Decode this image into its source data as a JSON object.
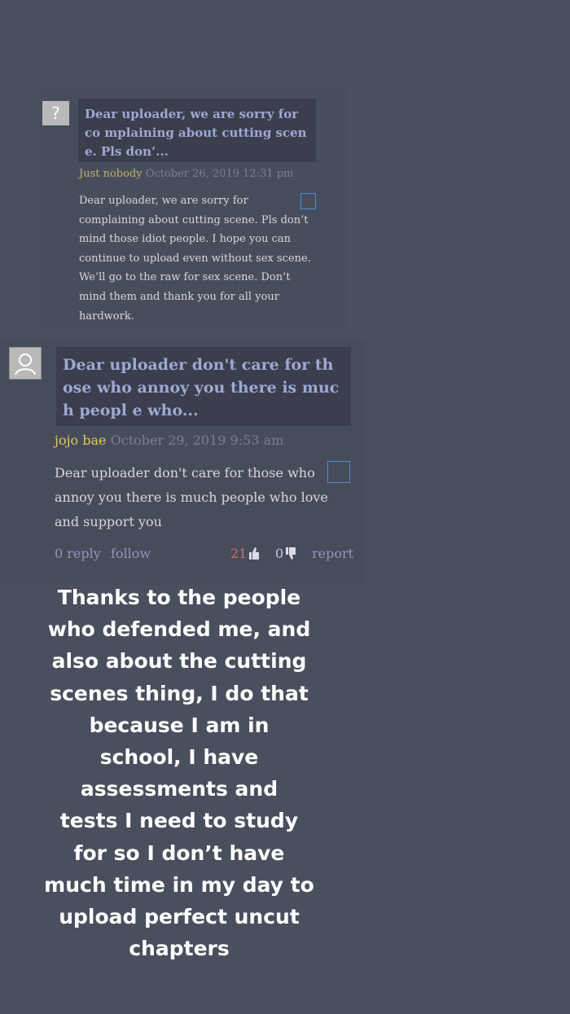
{
  "comment1": {
    "avatar_glyph": "?",
    "quote": "Dear uploader, we are sorry for co mplaining about cutting scene. Pls don’...",
    "username": "Just nobody",
    "timestamp": "October 26, 2019 12:31 pm",
    "body": "Dear uploader, we are sorry for complaining about cutting scene. Pls don’t mind those idiot people. I hope you can continue to upload even without sex scene. We’ll go to the raw for sex scene. Don’t mind them and thank you for all your hardwork."
  },
  "comment2": {
    "quote": "Dear uploader don't care for those who annoy you there is much peopl e who...",
    "username": "jojo bae",
    "timestamp": "October 29, 2019 9:53 am",
    "body": "Dear uploader don't care for those who annoy you there is much people who love and support you",
    "actions": {
      "reply": "0 reply",
      "follow": "follow",
      "likes": "21",
      "dislikes": "0",
      "report": "report"
    }
  },
  "caption_lines": [
    "Thanks to the people",
    "who defended me, and",
    "also about the cutting",
    "scenes thing, I do that",
    "because I am in",
    "school, I have",
    "assessments and",
    "tests I need to study",
    "for so I don’t have",
    "much time in my day to",
    "upload perfect uncut",
    "chapters"
  ],
  "colors": {
    "background": "#4a4f5e",
    "quote_bg": "#3b3e4d",
    "quote_text": "#9ea9d2",
    "username1": "#bfb16d",
    "username2": "#e0c95f",
    "likes": "#d66a6a",
    "link": "#8e97bd"
  },
  "icons": [
    "user-silhouette-icon",
    "thumbs-up-icon",
    "thumbs-down-icon",
    "edit-icon"
  ]
}
